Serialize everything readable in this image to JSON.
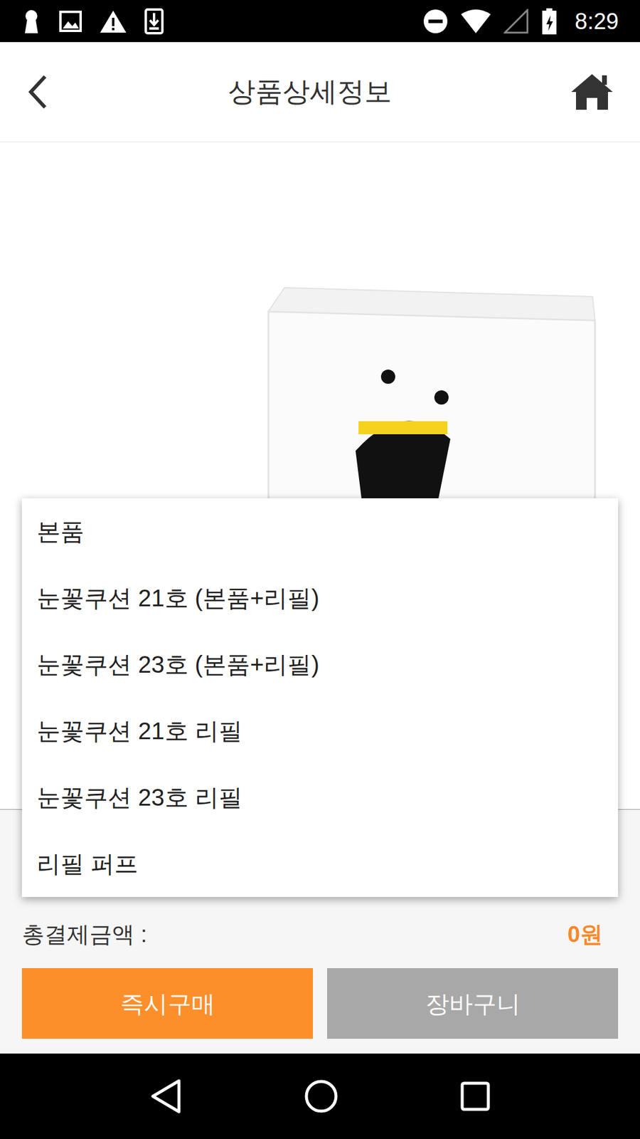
{
  "status_bar": {
    "time": "8:29"
  },
  "app_bar": {
    "title": "상품상세정보"
  },
  "dropdown": {
    "items": [
      {
        "label": "본품"
      },
      {
        "label": "눈꽃쿠션 21호 (본품+리필)"
      },
      {
        "label": "눈꽃쿠션 23호 (본품+리필)"
      },
      {
        "label": "눈꽃쿠션 21호 리필"
      },
      {
        "label": "눈꽃쿠션 23호 리필"
      },
      {
        "label": "리필 퍼프"
      }
    ]
  },
  "total": {
    "label": "총결제금액 :",
    "amount": "0원"
  },
  "buttons": [
    {
      "label": "즉시구매",
      "kind": "primary"
    },
    {
      "label": "장바구니",
      "kind": "secondary"
    }
  ]
}
